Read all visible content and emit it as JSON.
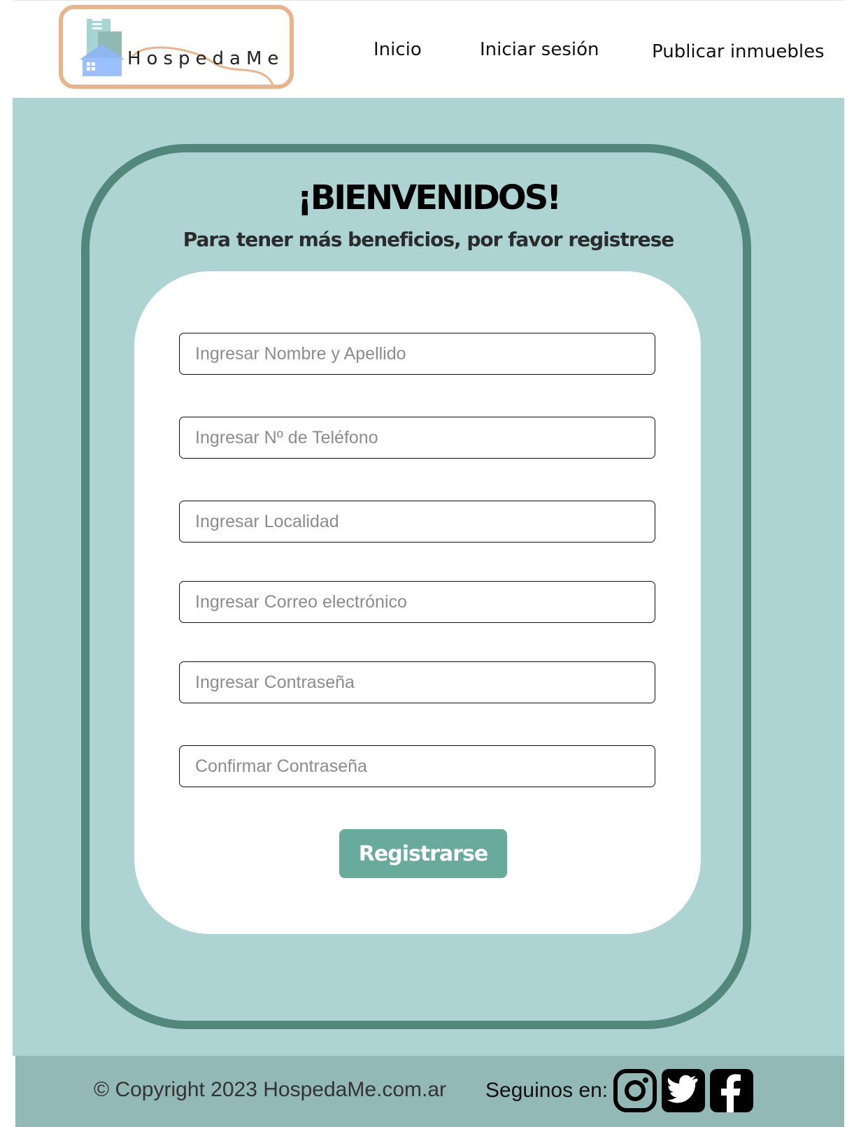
{
  "header": {
    "logo_text": "HospedaMe",
    "nav": {
      "inicio": "Inicio",
      "iniciar_sesion": "Iniciar sesión",
      "publicar": "Publicar inmuebles"
    }
  },
  "main": {
    "title": "¡BIENVENIDOS!",
    "subtitle": "Para tener más beneficios, por favor registrese",
    "form": {
      "nombre_placeholder": "Ingresar Nombre y Apellido",
      "telefono_placeholder": "Ingresar Nº de Teléfono",
      "localidad_placeholder": "Ingresar Localidad",
      "correo_placeholder": "Ingresar Correo electrónico",
      "contrasena_placeholder": "Ingresar Contraseña",
      "confirmar_placeholder": "Confirmar Contraseña",
      "submit_label": "Registrarse"
    }
  },
  "footer": {
    "copyright": "© Copyright 2023 HospedaMe.com.ar",
    "follow_label": "Seguinos en:",
    "social_icons": [
      "instagram-icon",
      "twitter-icon",
      "facebook-icon"
    ]
  },
  "colors": {
    "main_bg": "#add4d3",
    "frame": "#52877c",
    "button": "#68ab9c",
    "footer_bg": "#93b9b7",
    "logo_border": "#e9b48b"
  }
}
